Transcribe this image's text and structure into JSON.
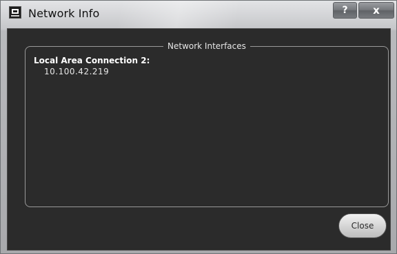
{
  "window": {
    "title": "Network Info",
    "help_label": "?",
    "close_label": "x",
    "app_icon": "app-icon"
  },
  "network_group": {
    "legend": "Network Interfaces",
    "interfaces": [
      {
        "name": "Local Area Connection 2:",
        "address": "10.100.42.219"
      }
    ]
  },
  "footer": {
    "close_button_label": "Close"
  }
}
